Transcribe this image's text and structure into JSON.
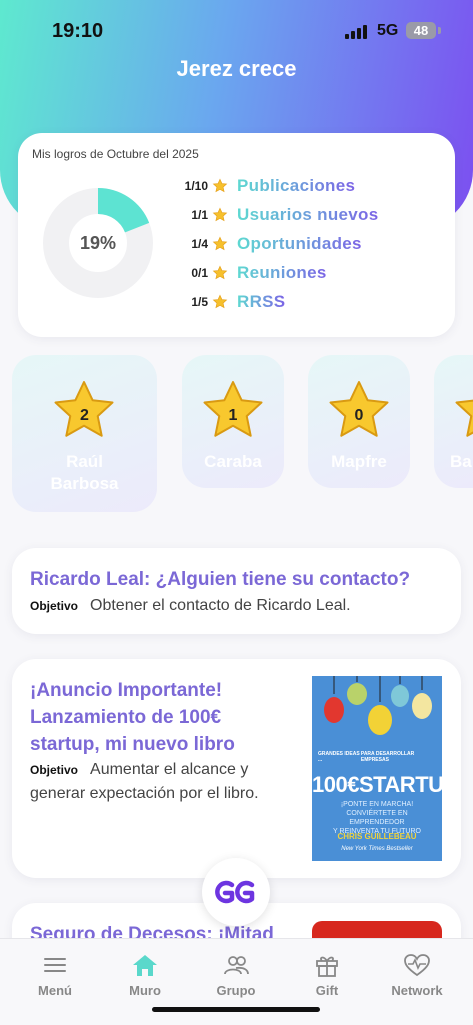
{
  "status_bar": {
    "time": "19:10",
    "network": "5G",
    "battery": "48"
  },
  "header": {
    "title": "Jerez crece"
  },
  "stats": {
    "label": "Mis logros de Octubre del 2025",
    "progress_text": "19%",
    "progress_fraction": 0.19,
    "goals": [
      {
        "count": "1/10",
        "label": "Publicaciones"
      },
      {
        "count": "1/1",
        "label": "Usuarios nuevos"
      },
      {
        "count": "1/4",
        "label": "Oportunidades"
      },
      {
        "count": "0/1",
        "label": "Reuniones"
      },
      {
        "count": "1/5",
        "label": "RRSS"
      }
    ]
  },
  "ranking": [
    {
      "score": "2",
      "name": "Raúl Barbosa"
    },
    {
      "score": "1",
      "name": "Caraba"
    },
    {
      "score": "0",
      "name": "Mapfre"
    },
    {
      "score": "",
      "name": "Ba"
    }
  ],
  "posts": [
    {
      "title": "Ricardo Leal: ¿Alguien tiene su contacto?",
      "objective_label": "Objetivo",
      "objective": "Obtener el contacto de Ricardo Leal."
    },
    {
      "title_lines": [
        "¡Anuncio Importante!",
        "Lanzamiento de 100€",
        "startup, mi nuevo libro"
      ],
      "objective_label": "Objetivo",
      "objective_lines": [
        "Aumentar el alcance y",
        "generar expectación por el libro."
      ],
      "book": {
        "small_left": "GRANDES IDEAS ...",
        "small_right": "PARA DESARROLLAR EMPRESAS",
        "title": "100€STARTUP",
        "subtitle_1": "¡PONTE EN MARCHA!",
        "subtitle_2": "CONVIÉRTETE EN EMPRENDEDOR",
        "subtitle_3": "Y REINVENTA TU FUTURO",
        "author": "CHRIS GUILLEBEAU",
        "badge": "New York Times Bestseller"
      }
    },
    {
      "title": "Seguro de Decesos: ¡Mitad"
    }
  ],
  "fab": {
    "icon": "gg-logo-icon"
  },
  "nav": {
    "items": [
      {
        "label": "Menú",
        "icon": "menu-icon"
      },
      {
        "label": "Muro",
        "icon": "home-icon",
        "active": true
      },
      {
        "label": "Grupo",
        "icon": "group-icon"
      },
      {
        "label": "Gift",
        "icon": "gift-icon"
      },
      {
        "label": "Network",
        "icon": "heartbeat-icon"
      }
    ]
  },
  "colors": {
    "header_gradient_start": "#5ee9cf",
    "header_gradient_end": "#7c4ff0",
    "accent_teal": "#5de3d2",
    "accent_purple": "#7b68d6",
    "nav_active": "#5ad8cb"
  }
}
